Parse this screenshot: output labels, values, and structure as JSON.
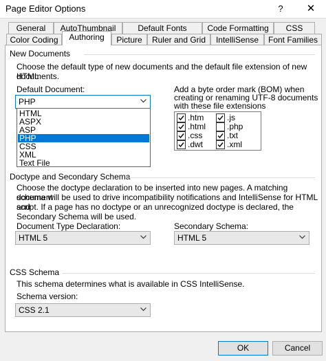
{
  "window": {
    "title": "Page Editor Options",
    "help_label": "?",
    "close_label": "✕"
  },
  "tabs_row1": [
    "General",
    "AutoThumbnail",
    "Default Fonts",
    "Code Formatting",
    "CSS"
  ],
  "tabs_row2": [
    "Color Coding",
    "Authoring",
    "Picture",
    "Ruler and Grid",
    "IntelliSense",
    "Font Families"
  ],
  "active_tab": "Authoring",
  "new_documents": {
    "group_title": "New Documents",
    "description_line1": "Choose the default type of new documents and the default file extension of new HTML",
    "description_line2": "documents.",
    "default_document_label": "Default Document:",
    "default_document_value": "PHP",
    "default_document_options": [
      "HTML",
      "ASPX",
      "ASP",
      "PHP",
      "CSS",
      "XML",
      "Text File"
    ],
    "bom_label_line1": "Add a byte order mark (BOM) when",
    "bom_label_line2": "creating or renaming UTF-8 documents",
    "bom_label_line3": "with these file extensions",
    "bom_extensions": [
      {
        "label": ".htm",
        "checked": true
      },
      {
        "label": ".js",
        "checked": true
      },
      {
        "label": ".html",
        "checked": true
      },
      {
        "label": ".php",
        "checked": false
      },
      {
        "label": ".css",
        "checked": true
      },
      {
        "label": ".txt",
        "checked": true
      },
      {
        "label": ".dwt",
        "checked": true
      },
      {
        "label": ".xml",
        "checked": true
      }
    ]
  },
  "doctype": {
    "group_title": "Doctype and Secondary Schema",
    "desc_line1": "Choose the doctype declaration to be inserted into new pages. A matching document",
    "desc_line2": "schema will be used to drive incompatibility notifications and IntelliSense for HTML and",
    "desc_line3": "script. If a page has no doctype or an unrecognized doctype is declared, the",
    "desc_line4": "Secondary Schema will be used.",
    "doctype_label": "Document Type Declaration:",
    "doctype_value": "HTML 5",
    "secondary_label": "Secondary Schema:",
    "secondary_value": "HTML 5"
  },
  "css_schema": {
    "group_title": "CSS Schema",
    "description": "This schema determines what is available in CSS IntelliSense.",
    "version_label": "Schema version:",
    "version_value": "CSS 2.1"
  },
  "buttons": {
    "ok": "OK",
    "cancel": "Cancel"
  },
  "dropdown_arrow": "chevron-down"
}
